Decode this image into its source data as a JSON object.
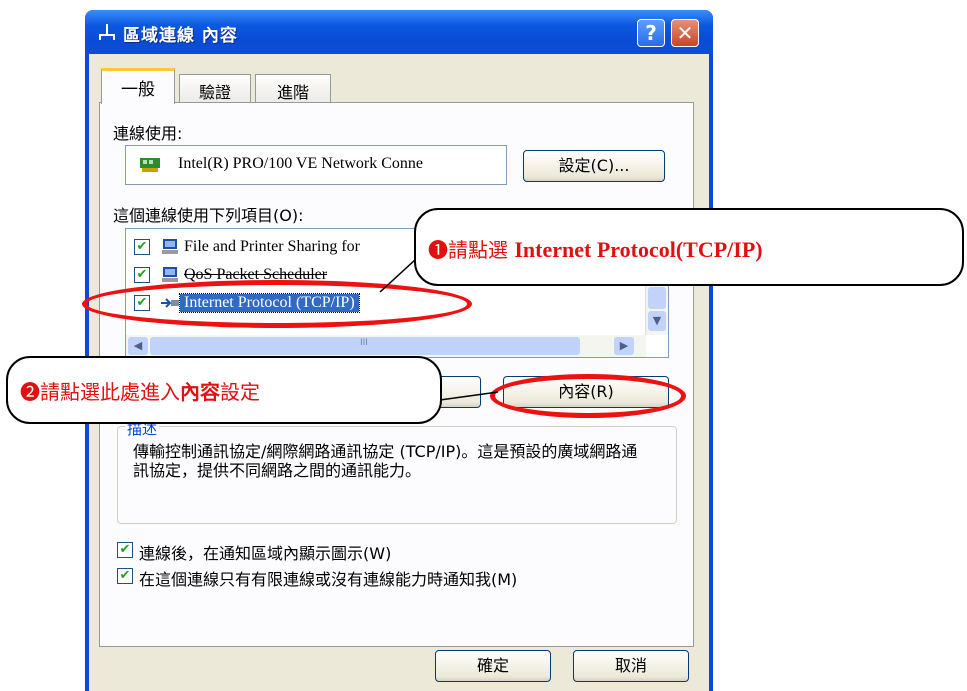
{
  "window": {
    "title": "區域連線 內容",
    "help_label": "?",
    "close_label": "✕"
  },
  "tabs": [
    "一般",
    "驗證",
    "進階"
  ],
  "connect_using": {
    "label": "連線使用:",
    "adapter": "Intel(R) PRO/100 VE Network Conne",
    "configure_button": "設定(C)..."
  },
  "components": {
    "label": "這個連線使用下列項目(O):",
    "items": [
      {
        "label": "File and Printer Sharing for",
        "checked": true,
        "selected": false,
        "icon": "network-computer-icon"
      },
      {
        "label": "QoS Packet Scheduler",
        "checked": true,
        "selected": false,
        "icon": "network-computer-icon"
      },
      {
        "label": "Internet Protocol (TCP/IP)",
        "checked": true,
        "selected": true,
        "icon": "protocol-icon"
      }
    ],
    "scroll_marker": "III"
  },
  "buttons": {
    "properties": "內容(R)",
    "ok": "確定",
    "cancel": "取消"
  },
  "description": {
    "title": "描述",
    "text": "傳輸控制通訊協定/網際網路通訊協定 (TCP/IP)。這是預設的廣域網路通訊協定，提供不同網路之間的通訊能力。"
  },
  "options": [
    {
      "label": "連線後，在通知區域內顯示圖示(W)",
      "checked": true
    },
    {
      "label": "在這個連線只有有限連線或沒有連線能力時通知我(M)",
      "checked": true
    }
  ],
  "annotations": [
    {
      "number": "❶",
      "prefix": "請點選 ",
      "bold": "Internet Protocol(TCP/IP)",
      "suffix": ""
    },
    {
      "number": "❷",
      "prefix": "請點選此處進入",
      "bold": "內容",
      "suffix": "設定"
    }
  ],
  "colors": {
    "annotation": "#e11111",
    "titlebar": "#0a4bd6",
    "selection": "#316ac5"
  }
}
